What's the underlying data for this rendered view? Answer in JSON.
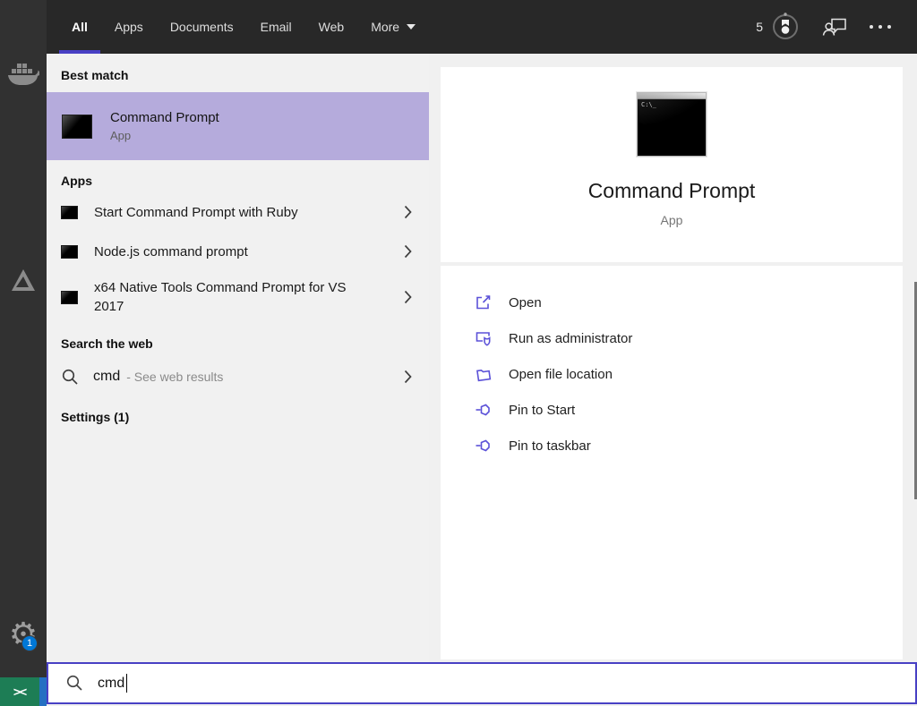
{
  "topbar": {
    "tabs": [
      "All",
      "Apps",
      "Documents",
      "Email",
      "Web"
    ],
    "more_label": "More",
    "rewards_count": "5"
  },
  "left_panel": {
    "best_match_header": "Best match",
    "best_match": {
      "title": "Command Prompt",
      "type": "App"
    },
    "apps_header": "Apps",
    "apps": [
      "Start Command Prompt with Ruby",
      "Node.js command prompt",
      "x64 Native Tools Command Prompt for VS 2017"
    ],
    "web_header": "Search the web",
    "web_query": "cmd",
    "web_hint": "- See web results",
    "settings_header": "Settings (1)"
  },
  "preview": {
    "title": "Command Prompt",
    "type": "App",
    "terminal_icon_label": "C:\\_",
    "actions": [
      "Open",
      "Run as administrator",
      "Open file location",
      "Pin to Start",
      "Pin to taskbar"
    ]
  },
  "search": {
    "value": "cmd"
  },
  "badges": {
    "settings_notification": "1"
  },
  "sidebar_icons": [
    "docker",
    "azure",
    "settings-gear",
    "vscode-remote"
  ],
  "colors": {
    "accent": "#4840c4",
    "selection": "#b5abdc",
    "action_icon": "#5b51d8",
    "rewards_badge_bg": "#0078d7"
  }
}
